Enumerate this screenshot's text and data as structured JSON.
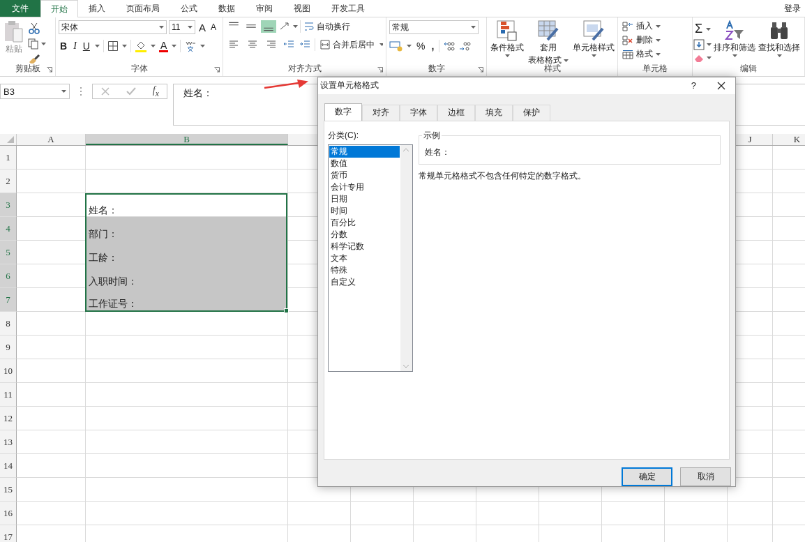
{
  "ribbon_tabs": [
    {
      "label": "文件",
      "kind": "file",
      "selected": false
    },
    {
      "label": "开始",
      "kind": "tab",
      "selected": true
    },
    {
      "label": "插入",
      "kind": "tab",
      "selected": false
    },
    {
      "label": "页面布局",
      "kind": "tab",
      "selected": false
    },
    {
      "label": "公式",
      "kind": "tab",
      "selected": false
    },
    {
      "label": "数据",
      "kind": "tab",
      "selected": false
    },
    {
      "label": "审阅",
      "kind": "tab",
      "selected": false
    },
    {
      "label": "视图",
      "kind": "tab",
      "selected": false
    },
    {
      "label": "开发工具",
      "kind": "tab",
      "selected": false
    }
  ],
  "account": "登录",
  "ribbon": {
    "clipboard": {
      "paste": "粘贴",
      "label": "剪贴板"
    },
    "font": {
      "name": "宋体",
      "size": "11",
      "grow": "A",
      "shrink": "A",
      "bold": "B",
      "italic": "I",
      "underline": "U",
      "font_color": "A",
      "label": "字体"
    },
    "alignment": {
      "vertical": [
        {
          "kind": "top",
          "on": false
        },
        {
          "kind": "middle",
          "on": false
        },
        {
          "kind": "bottom",
          "on": true
        }
      ],
      "wrap": "自动换行",
      "merge": "合并后居中",
      "label": "对齐方式"
    },
    "number": {
      "format": "常规",
      "percent": "%",
      "comma": ",",
      "label": "数字"
    },
    "styles": {
      "conditional": "条件格式",
      "table_format_1": "套用",
      "table_format_2": "表格格式",
      "cell_styles": "单元格样式",
      "label": "样式"
    },
    "cells": {
      "insert": "插入",
      "delete": "删除",
      "format": "格式",
      "label": "单元格"
    },
    "editing": {
      "sum": "Σ",
      "sort": "排序和筛选",
      "find": "查找和选择",
      "label": "编辑"
    }
  },
  "formula_bar": {
    "name_box": "B3",
    "insert_function": "f$_{x}$",
    "content": "姓名："
  },
  "sheet": {
    "columns": [
      {
        "label": "A",
        "selected": false
      },
      {
        "label": "B",
        "selected": true
      },
      {
        "label": "J",
        "selected": false
      },
      {
        "label": "K",
        "selected": false
      }
    ],
    "rows": [
      {
        "header": "1",
        "selected": false
      },
      {
        "header": "2",
        "selected": false
      },
      {
        "header": "3",
        "selected": true,
        "cell_b": "姓名："
      },
      {
        "header": "4",
        "selected": true,
        "cell_b": "部门："
      },
      {
        "header": "5",
        "selected": true,
        "cell_b": "工龄："
      },
      {
        "header": "6",
        "selected": true,
        "cell_b": "入职时间："
      },
      {
        "header": "7",
        "selected": true,
        "cell_b": "工作证号："
      },
      {
        "header": "8",
        "selected": false
      },
      {
        "header": "9",
        "selected": false
      },
      {
        "header": "10",
        "selected": false
      },
      {
        "header": "11",
        "selected": false
      },
      {
        "header": "12",
        "selected": false
      },
      {
        "header": "13",
        "selected": false
      },
      {
        "header": "14",
        "selected": false
      },
      {
        "header": "15",
        "selected": false
      },
      {
        "header": "16",
        "selected": false
      },
      {
        "header": "17",
        "selected": false
      }
    ]
  },
  "dialog": {
    "title": "设置单元格格式",
    "help": "?",
    "tabs": [
      {
        "label": "数字",
        "selected": true
      },
      {
        "label": "对齐",
        "selected": false
      },
      {
        "label": "字体",
        "selected": false
      },
      {
        "label": "边框",
        "selected": false
      },
      {
        "label": "填充",
        "selected": false
      },
      {
        "label": "保护",
        "selected": false
      }
    ],
    "category_label": "分类(C):",
    "categories": [
      {
        "label": "常规",
        "selected": true
      },
      {
        "label": "数值",
        "selected": false
      },
      {
        "label": "货币",
        "selected": false
      },
      {
        "label": "会计专用",
        "selected": false
      },
      {
        "label": "日期",
        "selected": false
      },
      {
        "label": "时间",
        "selected": false
      },
      {
        "label": "百分比",
        "selected": false
      },
      {
        "label": "分数",
        "selected": false
      },
      {
        "label": "科学记数",
        "selected": false
      },
      {
        "label": "文本",
        "selected": false
      },
      {
        "label": "特殊",
        "selected": false
      },
      {
        "label": "自定义",
        "selected": false
      }
    ],
    "sample": {
      "label": "示例",
      "value": "姓名："
    },
    "description": "常规单元格格式不包含任何特定的数字格式。",
    "buttons": [
      {
        "label": "确定",
        "default": true
      },
      {
        "label": "取消",
        "default": false
      }
    ]
  }
}
